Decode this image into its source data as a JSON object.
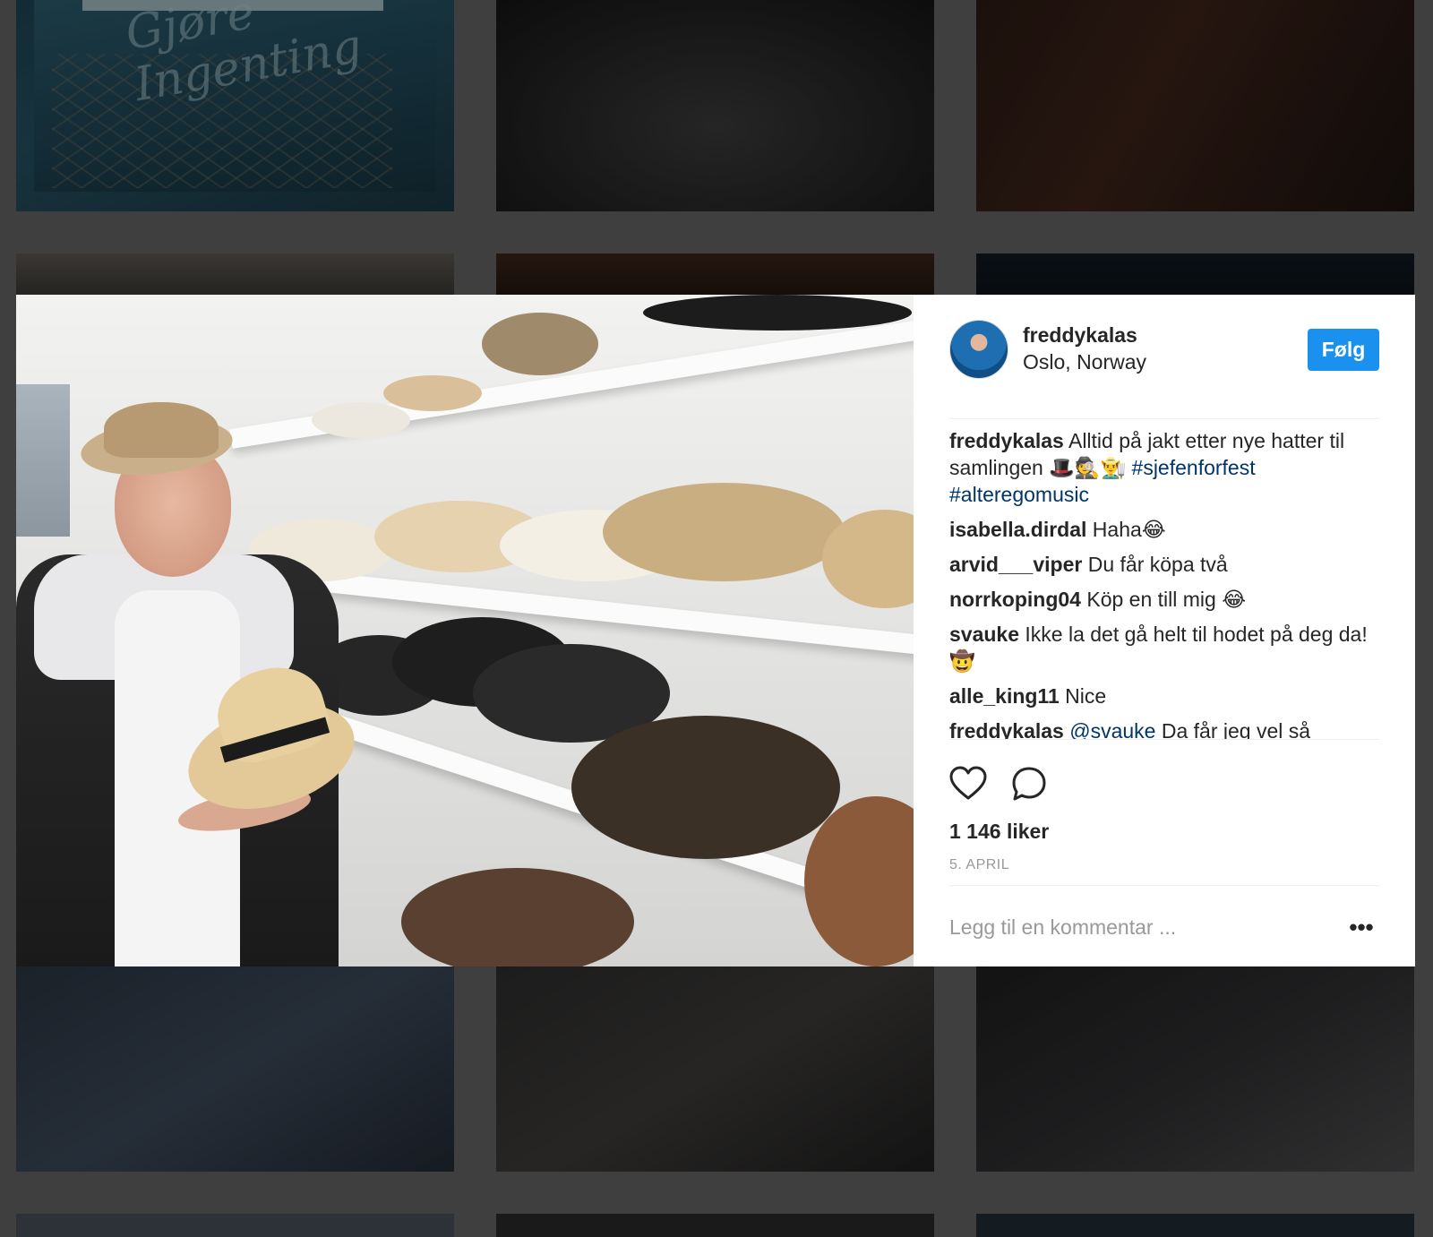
{
  "post": {
    "username": "freddykalas",
    "location": "Oslo, Norway",
    "follow_label": "Følg",
    "caption": {
      "username": "freddykalas",
      "text": "Alltid på jakt etter nye hatter til samlingen 🎩🕵️👨‍🌾 ",
      "hashtag_1": "#sjefenforfest",
      "hashtag_2": "#alteregomusic"
    },
    "comments": [
      {
        "username": "isabella.dirdal",
        "text": "Haha😂"
      },
      {
        "username": "arvid___viper",
        "text": "Du får köpa två"
      },
      {
        "username": "norrkoping04",
        "text": "Köp en till mig 😂"
      },
      {
        "username": "svauke",
        "text": "Ikke la det gå helt til hodet på deg da! 🤠"
      },
      {
        "username": "alle_king11",
        "text": "Nice"
      }
    ],
    "reply": {
      "username": "freddykalas",
      "mention": "@svauke",
      "text": "Da får jeg vel så"
    },
    "likes": "1 146 liker",
    "date": "5. APRIL",
    "comment_placeholder": "Legg til en kommentar ...",
    "more_label": "•••"
  },
  "background_grid": {
    "poster_text": "Gjøre\nIngenting"
  },
  "icons": {
    "like": "heart-outline-icon",
    "comment": "speech-bubble-icon",
    "more": "ellipsis-icon"
  },
  "colors": {
    "accent": "#1a91ee",
    "hashtag": "#003569",
    "muted": "#999999",
    "text": "#262626"
  }
}
